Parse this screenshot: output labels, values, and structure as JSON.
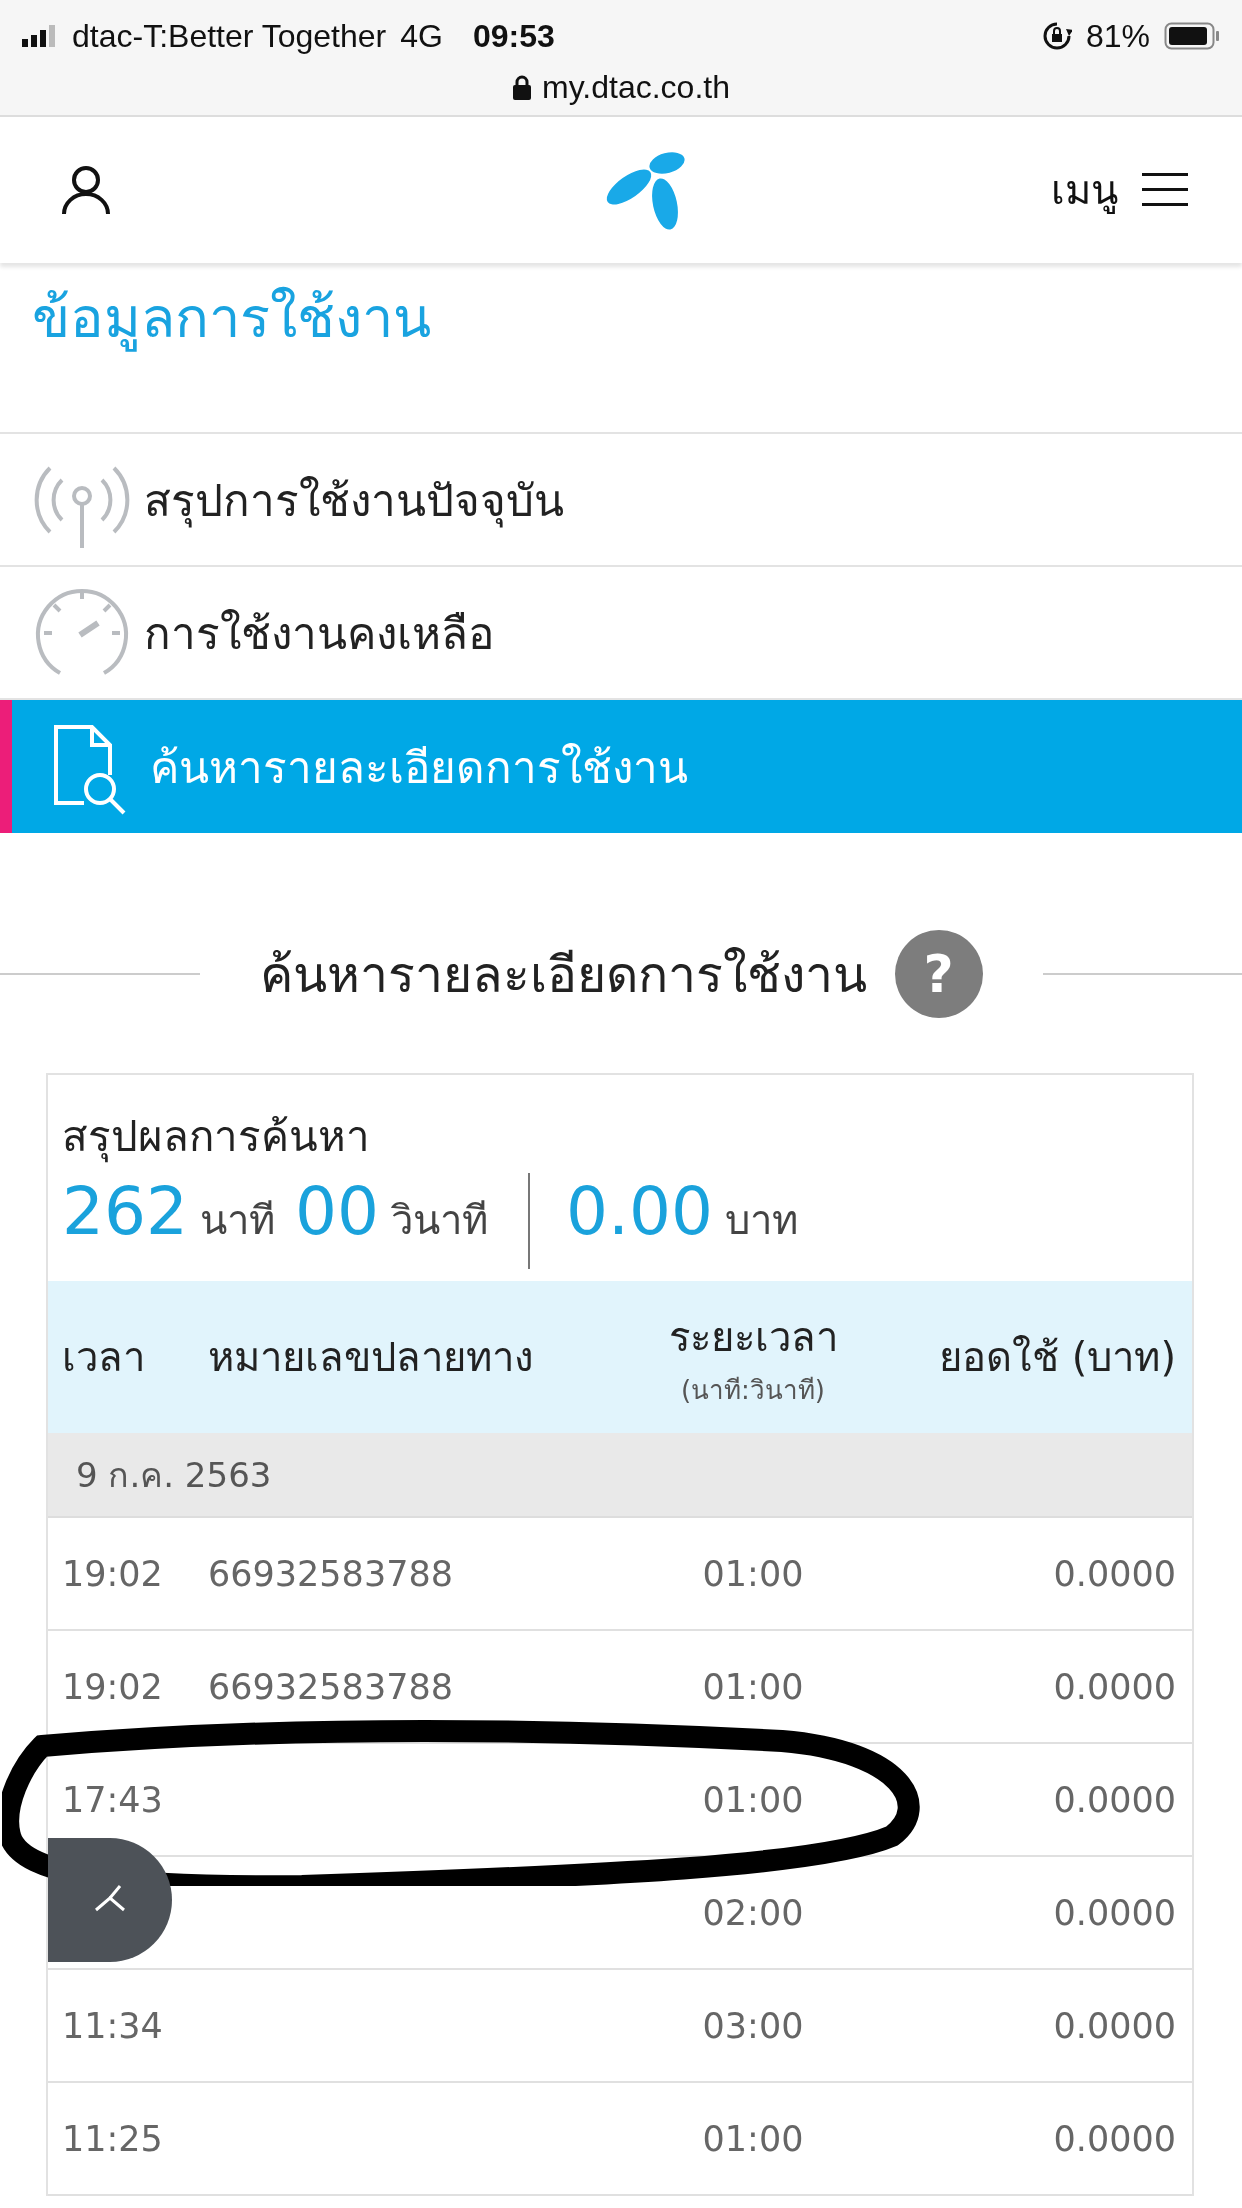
{
  "status_bar": {
    "carrier": "dtac-T:Better Together",
    "network": "4G",
    "time": "09:53",
    "battery": "81%",
    "url": "my.dtac.co.th"
  },
  "nav": {
    "menu_label": "เมนู"
  },
  "page_title": "ข้อมูลการใช้งาน",
  "menu_items": [
    {
      "label": "สรุปการใช้งานปัจจุบัน",
      "kind": "antenna",
      "selected": false
    },
    {
      "label": "การใช้งานคงเหลือ",
      "kind": "gauge",
      "selected": false
    },
    {
      "label": "ค้นหารายละเอียดการใช้งาน",
      "kind": "search-doc",
      "selected": true
    }
  ],
  "section_heading": "ค้นหารายละเอียดการใช้งาน",
  "help_icon": "?",
  "summary": {
    "title": "สรุปผลการค้นหา",
    "minutes": "262",
    "minutes_unit": "นาที",
    "seconds": "00",
    "seconds_unit": "วินาที",
    "amount": "0.00",
    "amount_unit": "บาท"
  },
  "table": {
    "columns": [
      {
        "label": "เวลา"
      },
      {
        "label": "หมายเลขปลายทาง"
      },
      {
        "label": "ระยะเวลา",
        "sub": "(นาที:วินาที)"
      },
      {
        "label": "ยอดใช้ (บาท)"
      }
    ],
    "date_group": "9 ก.ค. 2563",
    "rows": [
      {
        "time": "19:02",
        "number": "66932583788",
        "duration": "01:00",
        "amount": "0.0000"
      },
      {
        "time": "19:02",
        "number": "66932583788",
        "duration": "01:00",
        "amount": "0.0000"
      },
      {
        "time": "17:43",
        "duration": "01:00",
        "amount": "0.0000",
        "circled": true
      },
      {
        "duration": "02:00",
        "amount": "0.0000"
      },
      {
        "time": "11:34",
        "duration": "03:00",
        "amount": "0.0000"
      },
      {
        "time": "11:25",
        "duration": "01:00",
        "amount": "0.0000"
      }
    ]
  }
}
